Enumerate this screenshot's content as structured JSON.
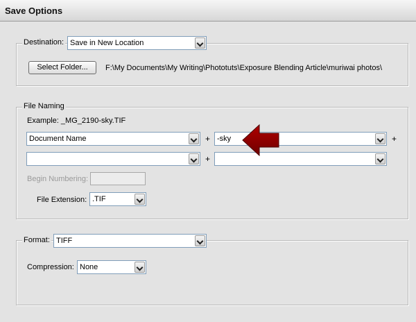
{
  "window": {
    "title": "Save Options"
  },
  "destination": {
    "label": "Destination:",
    "selected": "Save in New Location",
    "select_folder_button": "Select Folder...",
    "path": "F:\\My Documents\\My Writing\\Phototuts\\Exposure Blending Article\\muriwai photos\\"
  },
  "file_naming": {
    "legend": "File Naming",
    "example": "Example:  _MG_2190-sky.TIF",
    "row1_left": "Document Name",
    "row1_right": "-sky",
    "row2_left": "",
    "row2_right": "",
    "plus": "+",
    "begin_numbering_label": "Begin Numbering:",
    "begin_numbering_value": "",
    "file_extension_label": "File Extension:",
    "file_extension_value": ".TIF"
  },
  "format": {
    "label": "Format:",
    "selected": "TIFF",
    "compression_label": "Compression:",
    "compression_value": "None"
  },
  "colors": {
    "arrow_red": "#8b0000",
    "window_bg": "#e3e3e3"
  }
}
